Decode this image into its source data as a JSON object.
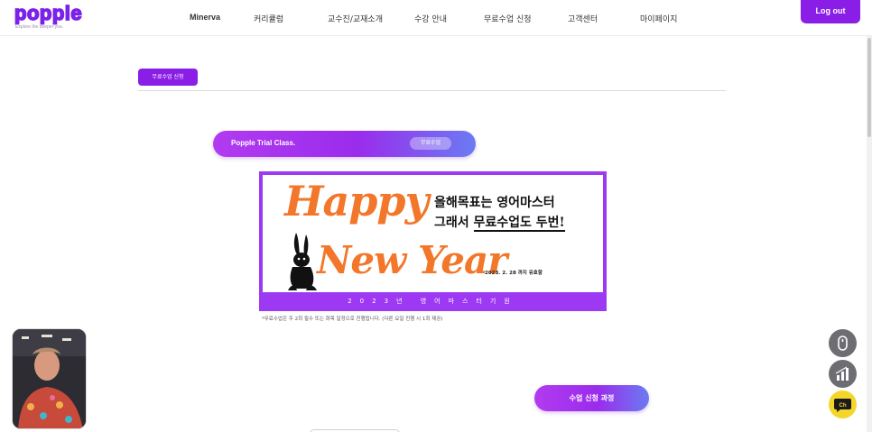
{
  "header": {
    "logo_text": "popple",
    "tagline": "Explore the deeper you.",
    "nav": [
      "Minerva",
      "커리큘럼",
      "교수진/교재소개",
      "수강 안내",
      "무료수업 신청",
      "고객센터",
      "마이페이지"
    ],
    "logout_label": "Log out"
  },
  "section": {
    "tag_label": "무료수업 신청"
  },
  "trial": {
    "title": "Popple Trial Class.",
    "chip_label": "무료수업"
  },
  "banner": {
    "happy_text": "Happy",
    "newyear_text": "New Year",
    "headline_line1": "올해목표는 영어마스터",
    "headline_line2_prefix": "그래서 ",
    "headline_line2_underlined": "무료수업도 두번!",
    "date_text": "2023. 2. 28 까지 유효함",
    "bottom_text": "2023년 영어마스터기원"
  },
  "note": "*무료수업은 주 2회 필수 또는 화목 일정으로 진행됩니다. (다른 요일 진행 시 1회 제공)",
  "cta_label": "수업 신청 과정",
  "fabs": {
    "channel_label": "Ch"
  },
  "colors": {
    "brand_purple": "#8a1ee6",
    "banner_purple": "#9d39f2",
    "banner_orange": "#f3772a",
    "channel_yellow": "#f4d62a"
  }
}
